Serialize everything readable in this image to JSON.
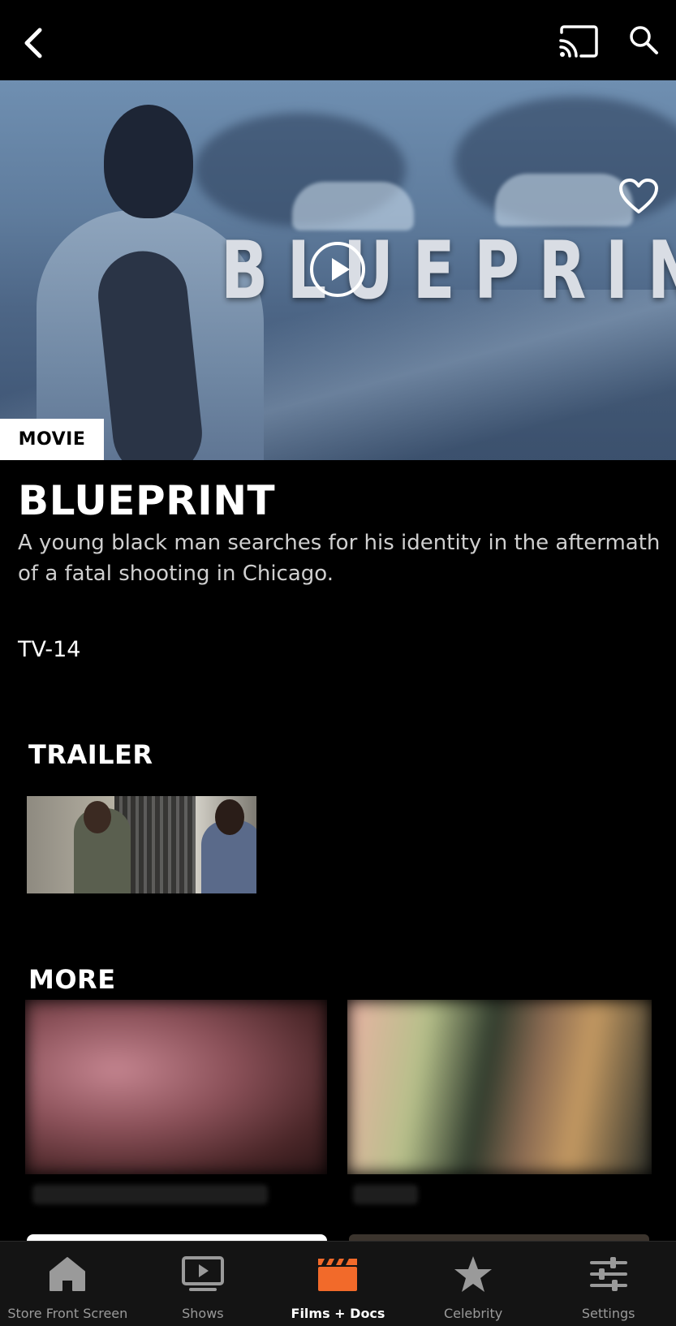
{
  "header": {
    "back_icon": "chevron-left-icon",
    "cast_icon": "cast-icon",
    "search_icon": "search-icon"
  },
  "hero": {
    "title_art": "BLUEPRINT",
    "badge": "MOVIE",
    "favorite_icon": "heart-outline-icon",
    "play_icon": "play-circle-icon"
  },
  "details": {
    "title": "BLUEPRINT",
    "description": "A young black man searches for his identity in the aftermath of a fatal shooting in Chicago.",
    "rating": "TV-14"
  },
  "sections": {
    "trailer_title": "TRAILER",
    "more_title": "MORE"
  },
  "tabs": [
    {
      "label": "Store Front Screen",
      "icon": "home-icon",
      "active": false
    },
    {
      "label": "Shows",
      "icon": "play-box-icon",
      "active": false
    },
    {
      "label": "Films + Docs",
      "icon": "clapperboard-icon",
      "active": true
    },
    {
      "label": "Celebrity",
      "icon": "star-icon",
      "active": false
    },
    {
      "label": "Settings",
      "icon": "sliders-icon",
      "active": false
    }
  ],
  "colors": {
    "background": "#000000",
    "tabbar": "#141414",
    "accent": "#F26A2A",
    "inactive_tab": "#9A9A9A"
  }
}
